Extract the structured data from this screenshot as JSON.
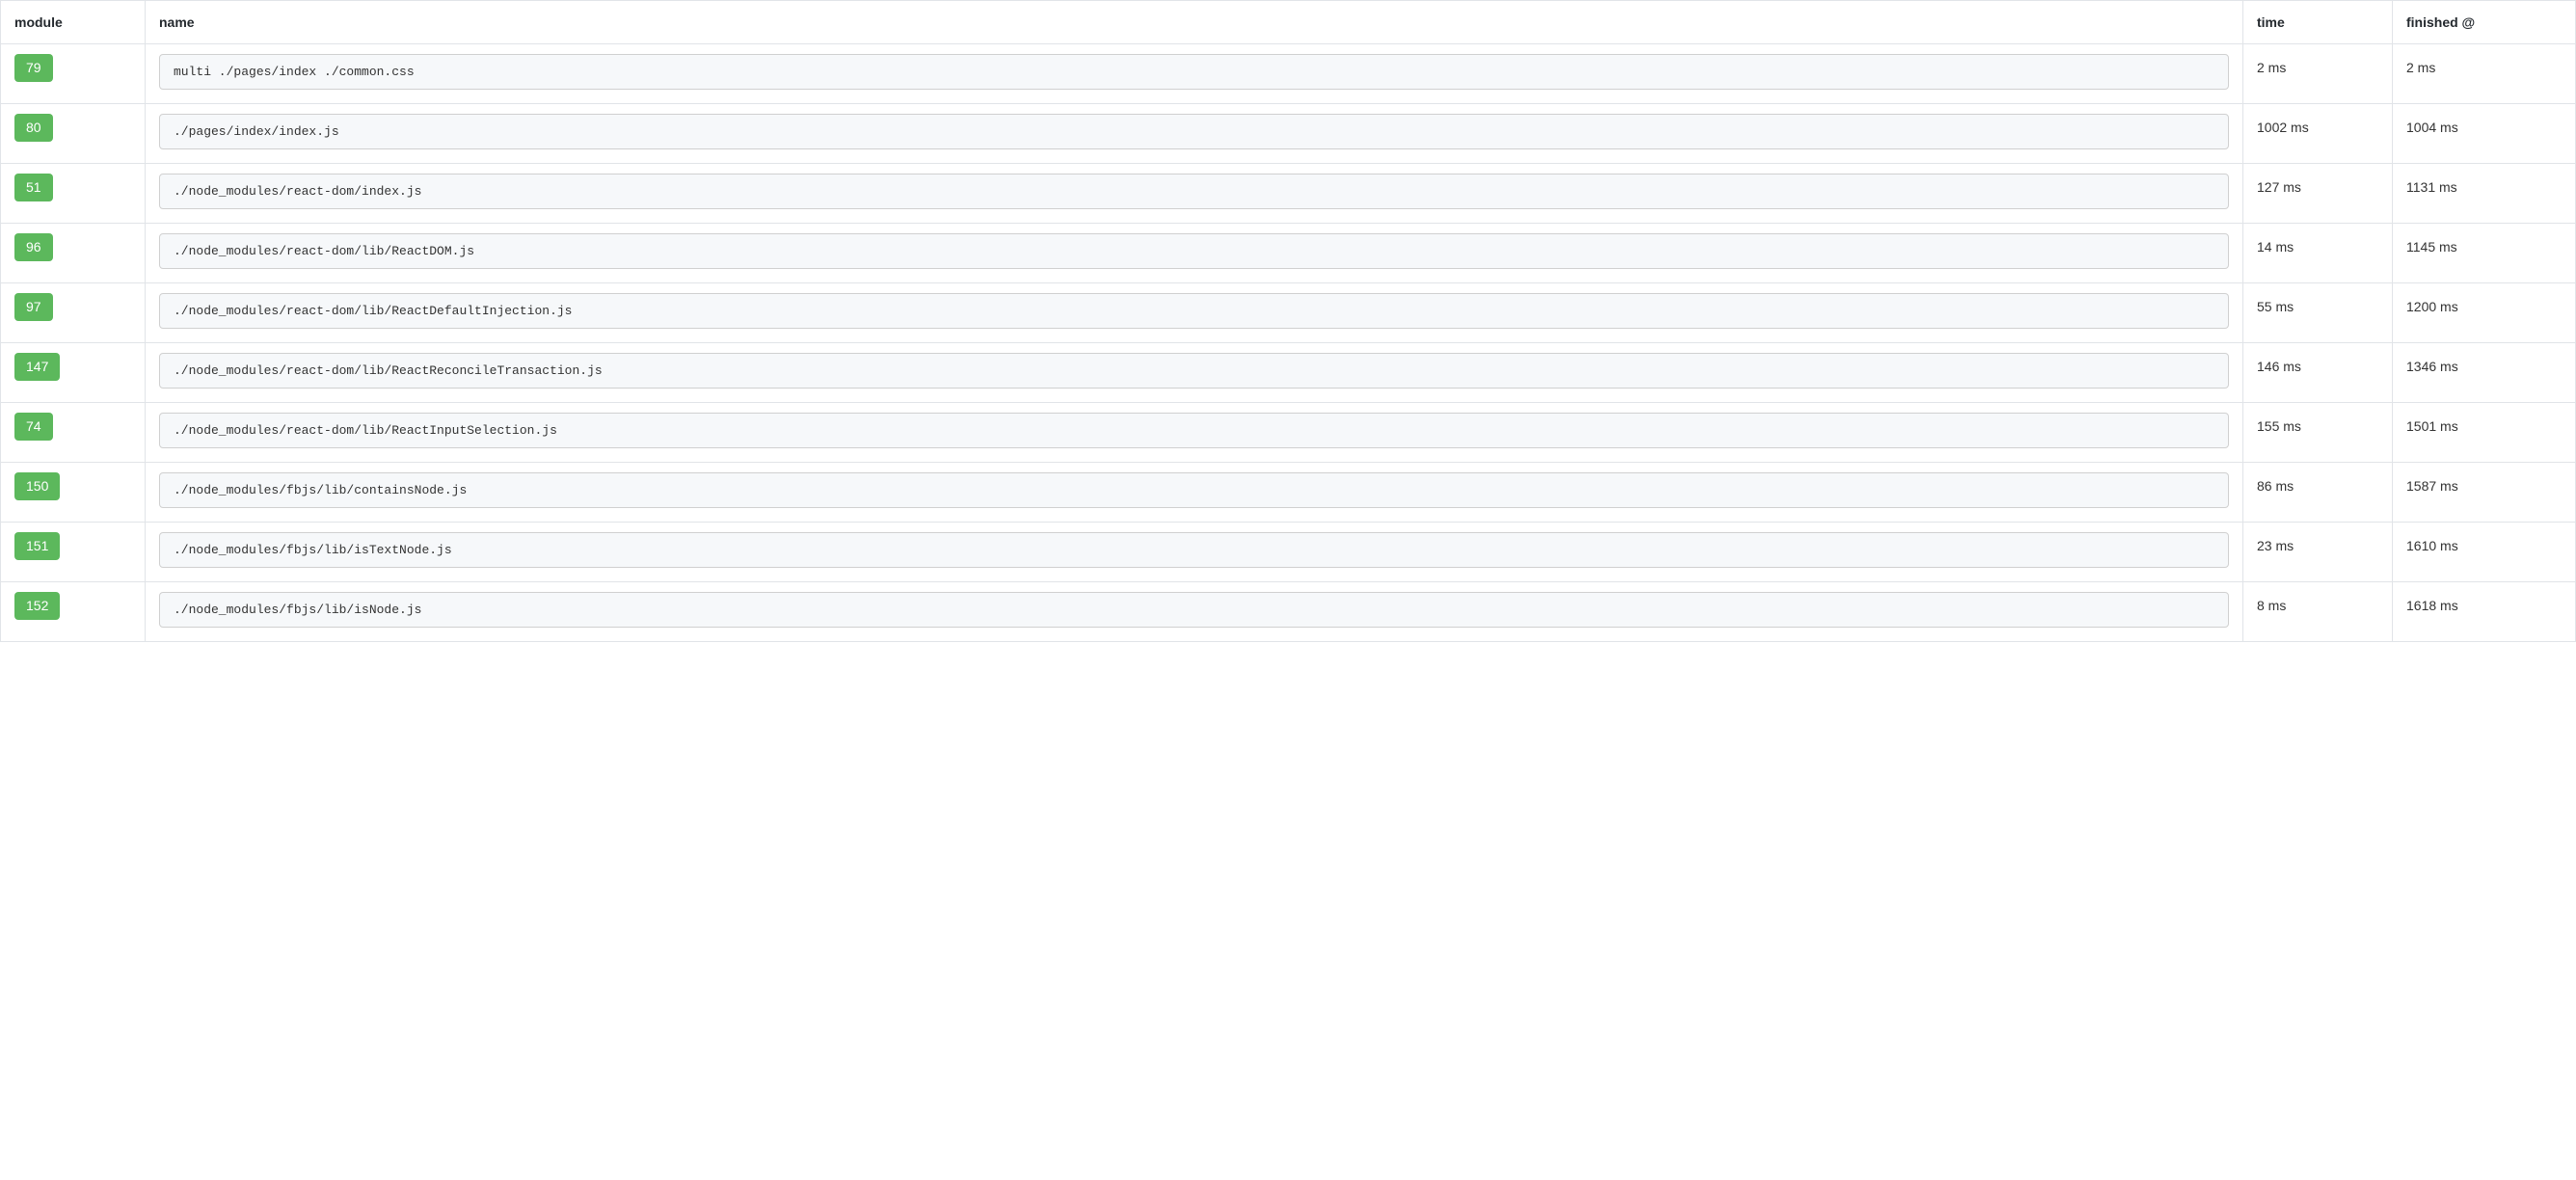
{
  "table": {
    "headers": {
      "module": "module",
      "name": "name",
      "time": "time",
      "finished": "finished @"
    },
    "rows": [
      {
        "module": "79",
        "name": "multi ./pages/index ./common.css",
        "time": "2 ms",
        "finished": "2 ms"
      },
      {
        "module": "80",
        "name": "./pages/index/index.js",
        "time": "1002 ms",
        "finished": "1004 ms"
      },
      {
        "module": "51",
        "name": "./node_modules/react-dom/index.js",
        "time": "127 ms",
        "finished": "1131 ms"
      },
      {
        "module": "96",
        "name": "./node_modules/react-dom/lib/ReactDOM.js",
        "time": "14 ms",
        "finished": "1145 ms"
      },
      {
        "module": "97",
        "name": "./node_modules/react-dom/lib/ReactDefaultInjection.js",
        "time": "55 ms",
        "finished": "1200 ms"
      },
      {
        "module": "147",
        "name": "./node_modules/react-dom/lib/ReactReconcileTransaction.js",
        "time": "146 ms",
        "finished": "1346 ms"
      },
      {
        "module": "74",
        "name": "./node_modules/react-dom/lib/ReactInputSelection.js",
        "time": "155 ms",
        "finished": "1501 ms"
      },
      {
        "module": "150",
        "name": "./node_modules/fbjs/lib/containsNode.js",
        "time": "86 ms",
        "finished": "1587 ms"
      },
      {
        "module": "151",
        "name": "./node_modules/fbjs/lib/isTextNode.js",
        "time": "23 ms",
        "finished": "1610 ms"
      },
      {
        "module": "152",
        "name": "./node_modules/fbjs/lib/isNode.js",
        "time": "8 ms",
        "finished": "1618 ms"
      }
    ]
  }
}
